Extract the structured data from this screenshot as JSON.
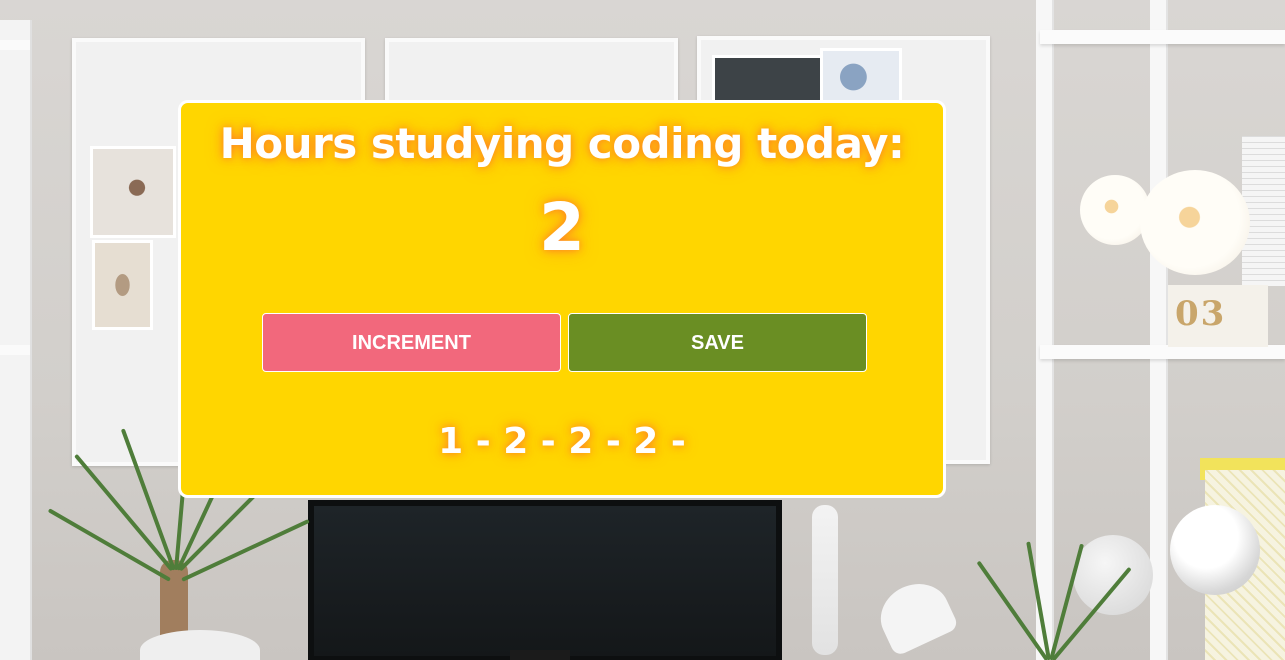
{
  "counter": {
    "title": "Hours studying coding today:",
    "value": "2"
  },
  "buttons": {
    "increment_label": "INCREMENT",
    "save_label": "SAVE"
  },
  "history": {
    "text": "1 - 2 - 2 - 2 -",
    "entries": [
      "1",
      "2",
      "2",
      "2"
    ]
  },
  "colors": {
    "card_background": "#ffd600",
    "card_border": "#ffffff",
    "increment_button": "#f2687c",
    "save_button": "#6a8e23",
    "text": "#ffffff",
    "text_glow": "#ff7828"
  }
}
